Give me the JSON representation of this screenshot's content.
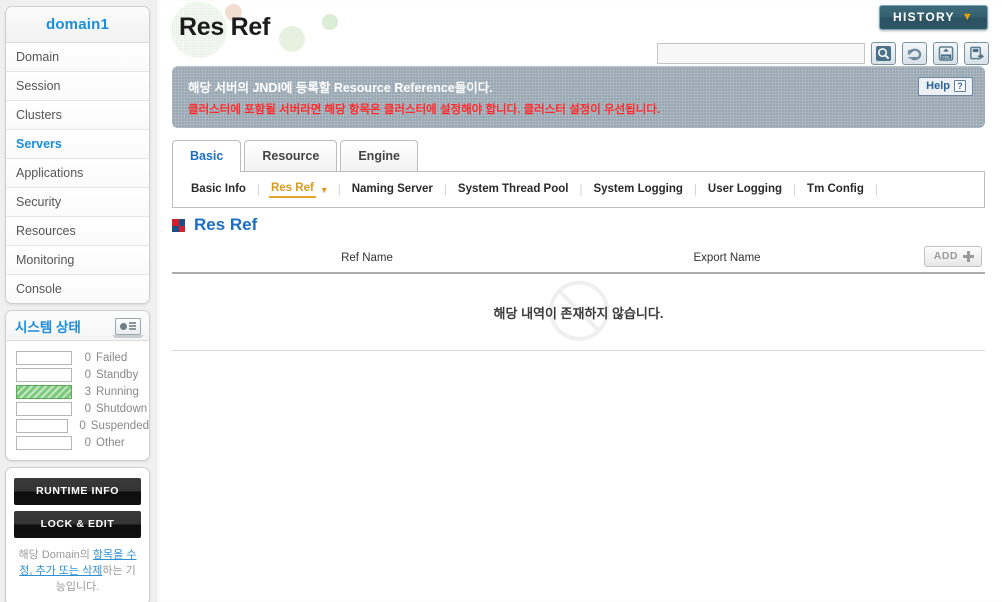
{
  "sidebar": {
    "domain_title": "domain1",
    "nav_items": [
      {
        "label": "Domain",
        "active": false
      },
      {
        "label": "Session",
        "active": false
      },
      {
        "label": "Clusters",
        "active": false
      },
      {
        "label": "Servers",
        "active": true
      },
      {
        "label": "Applications",
        "active": false
      },
      {
        "label": "Security",
        "active": false
      },
      {
        "label": "Resources",
        "active": false
      },
      {
        "label": "Monitoring",
        "active": false
      },
      {
        "label": "Console",
        "active": false
      }
    ],
    "status": {
      "title": "시스템 상태",
      "icon": "laptop-chart-icon",
      "rows": [
        {
          "count": "0",
          "label": "Failed",
          "filled": false
        },
        {
          "count": "0",
          "label": "Standby",
          "filled": false
        },
        {
          "count": "3",
          "label": "Running",
          "filled": true
        },
        {
          "count": "0",
          "label": "Shutdown",
          "filled": false
        },
        {
          "count": "0",
          "label": "Suspended",
          "filled": false
        },
        {
          "count": "0",
          "label": "Other",
          "filled": false
        }
      ],
      "fill_color": "#7dc97d"
    },
    "actions": {
      "runtime_info": "RUNTIME INFO",
      "lock_and_edit": "LOCK & EDIT",
      "help_prefix": "해당 Domain의 ",
      "help_link": "항목을 수정, 추가 또는 삭제",
      "help_suffix": "하는 기능입니다."
    }
  },
  "header": {
    "page_title": "Res Ref",
    "history_label": "HISTORY",
    "history_caret": "▼",
    "history_caret_color": "#f0a000",
    "search_value": "",
    "search_placeholder": "",
    "tools": [
      {
        "name": "search-icon",
        "title": "Search"
      },
      {
        "name": "refresh-icon",
        "title": "Refresh"
      },
      {
        "name": "xml-export-icon",
        "title": "XML"
      },
      {
        "name": "save-export-icon",
        "title": "Export"
      }
    ]
  },
  "banner": {
    "line1": "해당 서버의 JNDI에 등록할 Resource Reference들이다.",
    "line2": "클러스터에 포함될 서버라면 해당 항목은 클러스터에 설정해야 합니다. 클러스터 설정이 우선됩니다.",
    "line2_color": "#ff2d2d",
    "background_color": "#9aa8b3",
    "help_label": "Help",
    "help_icon": "?"
  },
  "tabs": [
    {
      "label": "Basic",
      "active": true
    },
    {
      "label": "Resource",
      "active": false
    },
    {
      "label": "Engine",
      "active": false
    }
  ],
  "subnav": [
    {
      "label": "Basic Info",
      "active": false,
      "caret": false
    },
    {
      "label": "Res Ref",
      "active": true,
      "caret": true
    },
    {
      "label": "Naming Server",
      "active": false,
      "caret": false
    },
    {
      "label": "System Thread Pool",
      "active": false,
      "caret": false
    },
    {
      "label": "System Logging",
      "active": false,
      "caret": false
    },
    {
      "label": "User Logging",
      "active": false,
      "caret": false
    },
    {
      "label": "Tm Config",
      "active": false,
      "caret": false
    }
  ],
  "section": {
    "title": "Res Ref",
    "icon": "square-marker-icon"
  },
  "table": {
    "columns": [
      "Ref Name",
      "Export Name"
    ],
    "add_label": "ADD",
    "add_icon": "plus-icon",
    "rows": [],
    "empty_message": "해당 내역이 존재하지 않습니다."
  }
}
